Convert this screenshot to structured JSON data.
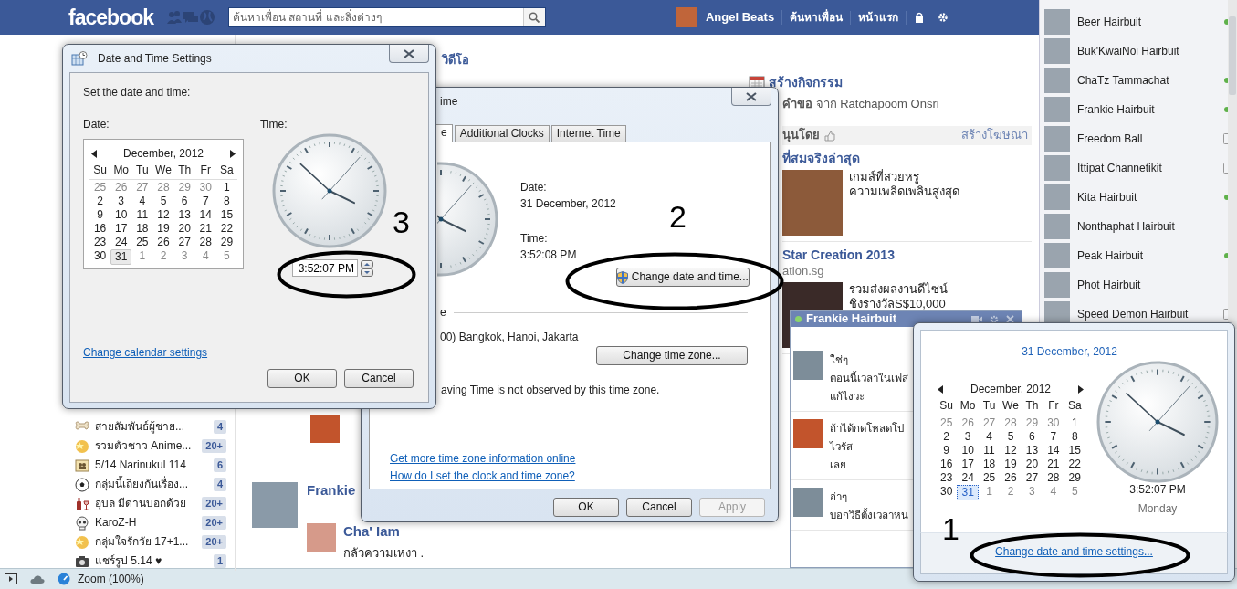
{
  "browser": {
    "header": {
      "logo": "facebook",
      "search_placeholder": "ค้นหาเพื่อน สถานที่ และสิ่งต่างๆ",
      "user_name": "Angel Beats",
      "links": [
        "ค้นหาเพื่อน",
        "หน้าแรก"
      ]
    },
    "groups": [
      {
        "name": "สายสัมพันธ์ผู้ชาย...",
        "count": "4"
      },
      {
        "name": "รวมตัวชาว Anime...",
        "count": "20+"
      },
      {
        "name": "5/14 Narinukul 114",
        "count": "6"
      },
      {
        "name": "กลุ่มนี้เถียงกันเรื่อง...",
        "count": "4"
      },
      {
        "name": "อุบล มีด่านบอกด้วย",
        "count": "20+"
      },
      {
        "name": "KaroZ-H",
        "count": "20+"
      },
      {
        "name": "กลุ่มใจรักวัย 17+1...",
        "count": "20+"
      },
      {
        "name": "แชร์รูป 5.14 ♥",
        "count": "1"
      }
    ],
    "feed": {
      "section_link": "วิดีโอ",
      "post_author": "Frankie",
      "comment_author": "Cha' Iam",
      "comment_text": "กลัวความเหงา ."
    },
    "right_column": {
      "create_event": "สร้างกิจกรรม",
      "request": "**คำขอ** จาก Ratchapoom Onsri",
      "sponsored": "นุนโดย",
      "create_ad": "สร้างโฆษณา",
      "ads": [
        {
          "title": "ที่สมจริงล่าสุด",
          "lines": [
            "เกมส์ที่สวยหรู",
            "ความเพลิดเพลินสูงสุด"
          ]
        },
        {
          "title": "Star Creation 2013",
          "domain": "ation.sg",
          "lines": [
            "ร่วมส่งผลงานดีไซน์",
            "ชิงรางวัลS$10,000"
          ]
        }
      ]
    },
    "chat_list": [
      {
        "name": "Beer Hairbuit",
        "online": true,
        "on_mobile": false
      },
      {
        "name": "Buk'KwaiNoi Hairbuit",
        "online": false,
        "on_mobile": false
      },
      {
        "name": "ChaTz Tammachat",
        "online": true,
        "on_mobile": false
      },
      {
        "name": "Frankie Hairbuit",
        "online": true,
        "on_mobile": false
      },
      {
        "name": "Freedom Ball",
        "online": false,
        "on_mobile": true
      },
      {
        "name": "Ittipat Channetikit",
        "online": false,
        "on_mobile": true
      },
      {
        "name": "Kita Hairbuit",
        "online": true,
        "on_mobile": false
      },
      {
        "name": "Nonthaphat Hairbuit",
        "online": false,
        "on_mobile": false
      },
      {
        "name": "Peak Hairbuit",
        "online": true,
        "on_mobile": false
      },
      {
        "name": "Phot Hairbuit",
        "online": false,
        "on_mobile": false
      },
      {
        "name": "Speed Demon Hairbuit",
        "online": false,
        "on_mobile": true
      }
    ],
    "chat_window": {
      "title": "Frankie Hairbuit",
      "online": true,
      "messages": [
        {
          "lines": [
            "ใช่ๆ",
            "ตอนนี้เวลาในเฟส",
            "แก้ไงวะ"
          ]
        },
        {
          "lines": [
            "ถ้าได้กดโหลดโป",
            "ไวรัส",
            "เลย"
          ]
        },
        {
          "lines": [
            "อ่าๆ",
            "บอกวิธีตั้งเวลาหน"
          ]
        }
      ]
    },
    "status_bar": {
      "zoom": "Zoom (100%)"
    }
  },
  "date_time_dialog": {
    "title": "ime",
    "tabs": [
      {
        "label": "e",
        "selected": true
      },
      {
        "label": "Additional Clocks",
        "selected": false
      },
      {
        "label": "Internet Time",
        "selected": false
      }
    ],
    "date_label": "Date:",
    "date": "31 December, 2012",
    "time_label": "Time:",
    "time": "3:52:08 PM",
    "change_button": "Change date and time...",
    "zone_heading": "e",
    "zone": "00) Bangkok, Hanoi, Jakarta",
    "zone_button": "Change time zone...",
    "dst_note": "aving Time is not observed by this time zone.",
    "links": [
      "Get more time zone information online",
      "How do I set the clock and time zone?"
    ],
    "buttons": [
      {
        "label": "OK",
        "disabled": false
      },
      {
        "label": "Cancel",
        "disabled": false
      },
      {
        "label": "Apply",
        "disabled": true
      }
    ]
  },
  "settings_dialog": {
    "title": "Date and Time Settings",
    "instruction": "Set the date and time:",
    "date_label": "Date:",
    "time_label": "Time:",
    "time_value": "3:52:07 PM",
    "link": "Change calendar settings",
    "calendar": {
      "month": "December, 2012",
      "weekdays": [
        "Su",
        "Mo",
        "Tu",
        "We",
        "Th",
        "Fr",
        "Sa"
      ],
      "weeks": [
        [
          {
            "day": "25",
            "other_month": true,
            "selected": false
          },
          {
            "day": "26",
            "other_month": true,
            "selected": false
          },
          {
            "day": "27",
            "other_month": true,
            "selected": false
          },
          {
            "day": "28",
            "other_month": true,
            "selected": false
          },
          {
            "day": "29",
            "other_month": true,
            "selected": false
          },
          {
            "day": "30",
            "other_month": true,
            "selected": false
          },
          {
            "day": "1",
            "other_month": false,
            "selected": false
          }
        ],
        [
          {
            "day": "2",
            "other_month": false,
            "selected": false
          },
          {
            "day": "3",
            "other_month": false,
            "selected": false
          },
          {
            "day": "4",
            "other_month": false,
            "selected": false
          },
          {
            "day": "5",
            "other_month": false,
            "selected": false
          },
          {
            "day": "6",
            "other_month": false,
            "selected": false
          },
          {
            "day": "7",
            "other_month": false,
            "selected": false
          },
          {
            "day": "8",
            "other_month": false,
            "selected": false
          }
        ],
        [
          {
            "day": "9",
            "other_month": false,
            "selected": false
          },
          {
            "day": "10",
            "other_month": false,
            "selected": false
          },
          {
            "day": "11",
            "other_month": false,
            "selected": false
          },
          {
            "day": "12",
            "other_month": false,
            "selected": false
          },
          {
            "day": "13",
            "other_month": false,
            "selected": false
          },
          {
            "day": "14",
            "other_month": false,
            "selected": false
          },
          {
            "day": "15",
            "other_month": false,
            "selected": false
          }
        ],
        [
          {
            "day": "16",
            "other_month": false,
            "selected": false
          },
          {
            "day": "17",
            "other_month": false,
            "selected": false
          },
          {
            "day": "18",
            "other_month": false,
            "selected": false
          },
          {
            "day": "19",
            "other_month": false,
            "selected": false
          },
          {
            "day": "20",
            "other_month": false,
            "selected": false
          },
          {
            "day": "21",
            "other_month": false,
            "selected": false
          },
          {
            "day": "22",
            "other_month": false,
            "selected": false
          }
        ],
        [
          {
            "day": "23",
            "other_month": false,
            "selected": false
          },
          {
            "day": "24",
            "other_month": false,
            "selected": false
          },
          {
            "day": "25",
            "other_month": false,
            "selected": false
          },
          {
            "day": "26",
            "other_month": false,
            "selected": false
          },
          {
            "day": "27",
            "other_month": false,
            "selected": false
          },
          {
            "day": "28",
            "other_month": false,
            "selected": false
          },
          {
            "day": "29",
            "other_month": false,
            "selected": false
          }
        ],
        [
          {
            "day": "30",
            "other_month": false,
            "selected": false
          },
          {
            "day": "31",
            "other_month": false,
            "selected": true
          },
          {
            "day": "1",
            "other_month": true,
            "selected": false
          },
          {
            "day": "2",
            "other_month": true,
            "selected": false
          },
          {
            "day": "3",
            "other_month": true,
            "selected": false
          },
          {
            "day": "4",
            "other_month": true,
            "selected": false
          },
          {
            "day": "5",
            "other_month": true,
            "selected": false
          }
        ]
      ]
    },
    "buttons": [
      "OK",
      "Cancel"
    ]
  },
  "clock_popup": {
    "date_heading": "31 December, 2012",
    "time": "3:52:07 PM",
    "weekday": "Monday",
    "link": "Change date and time settings...",
    "calendar": {
      "month": "December, 2012",
      "weekdays": [
        "Su",
        "Mo",
        "Tu",
        "We",
        "Th",
        "Fr",
        "Sa"
      ],
      "weeks": [
        [
          {
            "day": "25",
            "other_month": true,
            "selected": false
          },
          {
            "day": "26",
            "other_month": true,
            "selected": false
          },
          {
            "day": "27",
            "other_month": true,
            "selected": false
          },
          {
            "day": "28",
            "other_month": true,
            "selected": false
          },
          {
            "day": "29",
            "other_month": true,
            "selected": false
          },
          {
            "day": "30",
            "other_month": true,
            "selected": false
          },
          {
            "day": "1",
            "other_month": false,
            "selected": false
          }
        ],
        [
          {
            "day": "2",
            "other_month": false,
            "selected": false
          },
          {
            "day": "3",
            "other_month": false,
            "selected": false
          },
          {
            "day": "4",
            "other_month": false,
            "selected": false
          },
          {
            "day": "5",
            "other_month": false,
            "selected": false
          },
          {
            "day": "6",
            "other_month": false,
            "selected": false
          },
          {
            "day": "7",
            "other_month": false,
            "selected": false
          },
          {
            "day": "8",
            "other_month": false,
            "selected": false
          }
        ],
        [
          {
            "day": "9",
            "other_month": false,
            "selected": false
          },
          {
            "day": "10",
            "other_month": false,
            "selected": false
          },
          {
            "day": "11",
            "other_month": false,
            "selected": false
          },
          {
            "day": "12",
            "other_month": false,
            "selected": false
          },
          {
            "day": "13",
            "other_month": false,
            "selected": false
          },
          {
            "day": "14",
            "other_month": false,
            "selected": false
          },
          {
            "day": "15",
            "other_month": false,
            "selected": false
          }
        ],
        [
          {
            "day": "16",
            "other_month": false,
            "selected": false
          },
          {
            "day": "17",
            "other_month": false,
            "selected": false
          },
          {
            "day": "18",
            "other_month": false,
            "selected": false
          },
          {
            "day": "19",
            "other_month": false,
            "selected": false
          },
          {
            "day": "20",
            "other_month": false,
            "selected": false
          },
          {
            "day": "21",
            "other_month": false,
            "selected": false
          },
          {
            "day": "22",
            "other_month": false,
            "selected": false
          }
        ],
        [
          {
            "day": "23",
            "other_month": false,
            "selected": false
          },
          {
            "day": "24",
            "other_month": false,
            "selected": false
          },
          {
            "day": "25",
            "other_month": false,
            "selected": false
          },
          {
            "day": "26",
            "other_month": false,
            "selected": false
          },
          {
            "day": "27",
            "other_month": false,
            "selected": false
          },
          {
            "day": "28",
            "other_month": false,
            "selected": false
          },
          {
            "day": "29",
            "other_month": false,
            "selected": false
          }
        ],
        [
          {
            "day": "30",
            "other_month": false,
            "selected": false
          },
          {
            "day": "31",
            "other_month": false,
            "selected": true
          },
          {
            "day": "1",
            "other_month": true,
            "selected": false
          },
          {
            "day": "2",
            "other_month": true,
            "selected": false
          },
          {
            "day": "3",
            "other_month": true,
            "selected": false
          },
          {
            "day": "4",
            "other_month": true,
            "selected": false
          },
          {
            "day": "5",
            "other_month": true,
            "selected": false
          }
        ]
      ]
    }
  },
  "annotations": [
    "1",
    "2",
    "3"
  ]
}
